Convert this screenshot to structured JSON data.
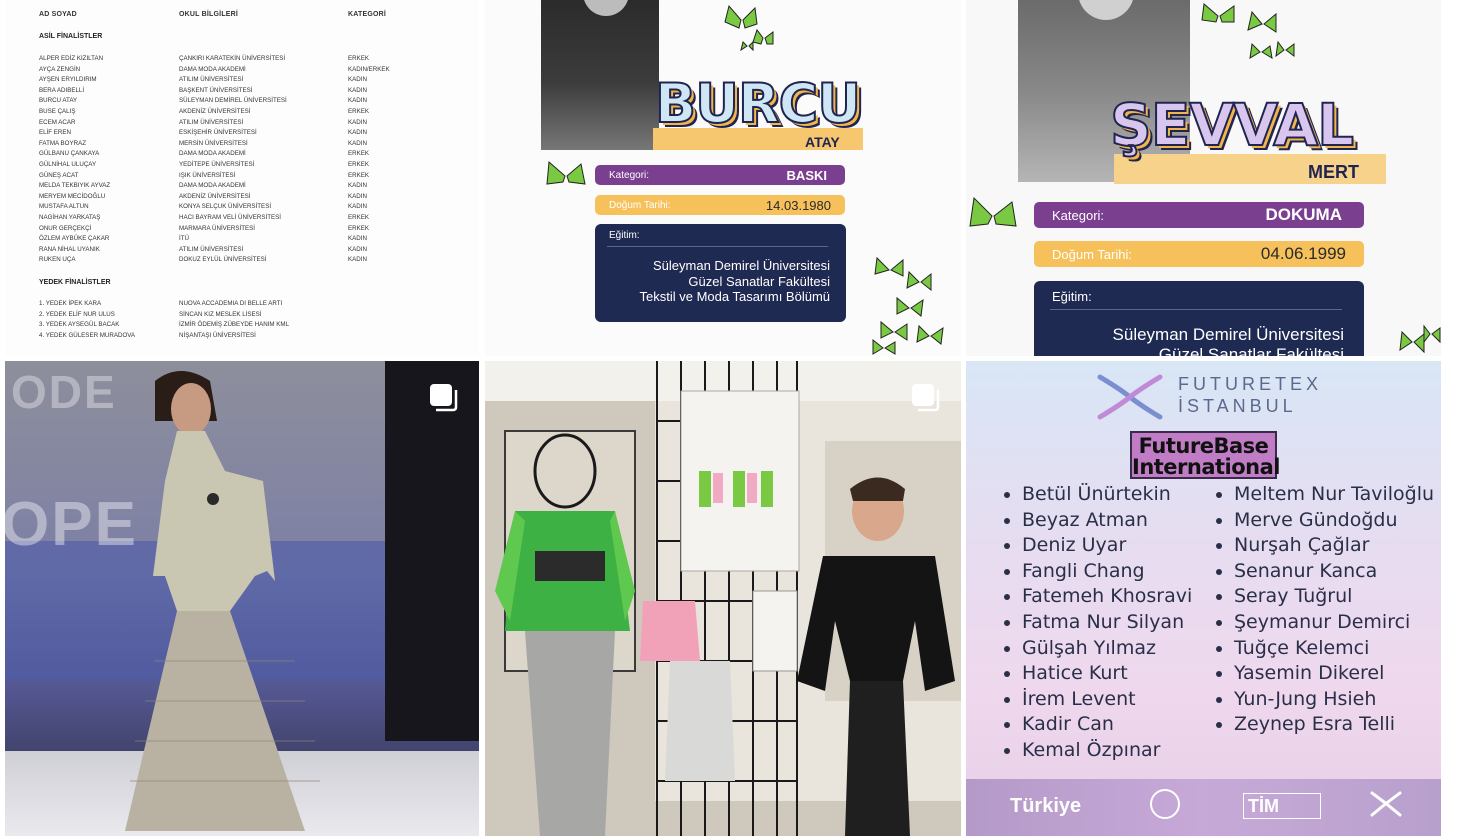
{
  "tile1": {
    "headers": [
      "AD SOYAD",
      "OKUL BİLGİLERİ",
      "KATEGORİ"
    ],
    "section_main": "ASİL FİNALİSTLER",
    "section_reserve": "YEDEK FİNALİSTLER",
    "names": [
      "ALPER EDİZ KIZILTAN",
      "AYÇA ZENGİN",
      "AYŞEN ERYILDIRIM",
      "BERA ADIBELLİ",
      "BURCU ATAY",
      "BUSE ÇALIŞ",
      "ECEM ACAR",
      "ELİF EREN",
      "FATMA BOYRAZ",
      "GÜLBANU ÇANKAYA",
      "GÜLNİHAL ULUÇAY",
      "GÜNEŞ ACAT",
      "MELDA TEKBIYIK AYVAZ",
      "MERYEM MECİDOĞLU",
      "MUSTAFA ALTUN",
      "NAGİHAN YARKATAŞ",
      "ONUR GERÇEKÇİ",
      "ÖZLEM AYBÜKE ÇAKAR",
      "RANA NİHAL UYANIK",
      "RUKEN UÇA"
    ],
    "schools": [
      "ÇANKIRI KARATEKİN ÜNİVERSİTESİ",
      "DAMA MODA AKADEMİ",
      "ATILIM ÜNİVERSİTESİ",
      "BAŞKENT ÜNİVERSİTESİ",
      "SÜLEYMAN DEMİREL ÜNİVERSİTESİ",
      "AKDENİZ ÜNİVERSİTESİ",
      "ATILIM ÜNİVERSİTESİ",
      "ESKİŞEHİR ÜNİVERSİTESİ",
      "MERSİN ÜNİVERSİTESİ",
      "DAMA MODA AKADEMİ",
      "YEDİTEPE ÜNİVERSİTESİ",
      "IŞIK ÜNİVERSİTESİ",
      "DAMA MODA AKADEMİ",
      "AKDENİZ ÜNİVERSİTESİ",
      "KONYA SELÇUK ÜNİVERSİTESİ",
      "HACI BAYRAM VELİ ÜNİVERSİTESİ",
      "MARMARA ÜNİVERSİTESİ",
      "İTÜ",
      "ATILIM ÜNİVERSİTESİ",
      "DOKUZ EYLÜL ÜNİVERSİTESİ"
    ],
    "categories": [
      "ERKEK",
      "KADIN/ERKEK",
      "KADIN",
      "KADIN",
      "KADIN",
      "ERKEK",
      "KADIN",
      "KADIN",
      "KADIN",
      "ERKEK",
      "ERKEK",
      "ERKEK",
      "KADIN",
      "KADIN",
      "KADIN",
      "ERKEK",
      "ERKEK",
      "KADIN",
      "KADIN",
      "KADIN"
    ],
    "reserve_names": [
      "1. YEDEK İPEK KARA",
      "2. YEDEK ELİF NUR ULUS",
      "3. YEDEK AYSEGÜL BACAK",
      "4. YEDEK GÜLESER MURADOVA"
    ],
    "reserve_schools": [
      "NUOVA ACCADEMIA DI BELLE ARTI",
      "SİNCAN KIZ MESLEK LİSESİ",
      "İZMİR ÖDEMİŞ ZÜBEYDE HANIM KML",
      "NİŞANTAŞI ÜNİVERSİTESİ"
    ]
  },
  "tile2": {
    "first_name": "BURCU",
    "last_name": "ATAY",
    "category_label": "Kategori:",
    "category_value": "BASKI",
    "birth_label": "Doğum Tarihi:",
    "birth_value": "14.03.1980",
    "edu_label": "Eğitim:",
    "edu_line1": "Süleyman Demirel Üniversitesi",
    "edu_line2": "Güzel Sanatlar Fakültesi",
    "edu_line3": "Tekstil ve Moda Tasarımı Bölümü"
  },
  "tile3": {
    "first_name": "ŞEVVAL",
    "last_name": "MERT",
    "category_label": "Kategori:",
    "category_value": "DOKUMA",
    "birth_label": "Doğum Tarihi:",
    "birth_value": "04.06.1999",
    "edu_label": "Eğitim:",
    "edu_line1": "Süleyman Demirel Üniversitesi",
    "edu_line2": "Güzel Sanatlar Fakültesi"
  },
  "tile4": {
    "backdrop_text_1": "ODE",
    "backdrop_text_2": "OPE",
    "icon": "multiple-posts-icon"
  },
  "tile5": {
    "icon": "multiple-posts-icon"
  },
  "tile6": {
    "brand_line1": "FUTURETEX",
    "brand_line2": "İSTANBUL",
    "box_line1": "FutureBase",
    "box_line2": "International",
    "left_names": [
      "Betül Ünürtekin",
      "Beyaz Atman",
      "Deniz Uyar",
      "Fangli Chang",
      "Fatemeh Khosravi",
      "Fatma Nur Silyan",
      "Gülşah Yılmaz",
      "Hatice Kurt",
      "İrem Levent",
      "Kadir Can",
      "Kemal Özpınar"
    ],
    "right_names": [
      "Meltem Nur Taviloğlu",
      "Merve Gündoğdu",
      "Nurşah Çağlar",
      "Senanur Kanca",
      "Seray Tuğrul",
      "Şeymanur Demirci",
      "Tuğçe Kelemci",
      "Yasemin Dikerel",
      "Yun-Jung Hsieh",
      "Zeynep Esra Telli"
    ],
    "footer_country": "Türkiye",
    "footer_tim": "TİM"
  },
  "colors": {
    "navy": "#1f2a52",
    "purple": "#7b3f8f",
    "yellow": "#f6c15a",
    "butterfly_green": "#7ac943"
  }
}
